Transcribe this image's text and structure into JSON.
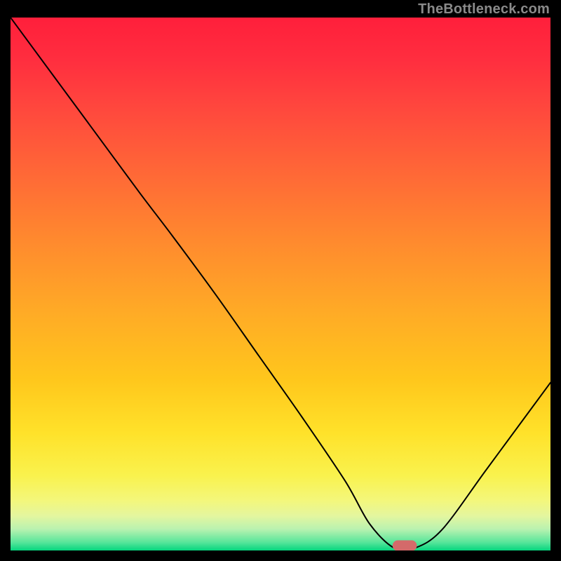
{
  "watermark": "TheBottleneck.com",
  "chart_data": {
    "type": "line",
    "title": "",
    "xlabel": "",
    "ylabel": "",
    "xlim": [
      0,
      100
    ],
    "ylim": [
      0,
      100
    ],
    "grid": false,
    "legend": false,
    "series": [
      {
        "name": "bottleneck-curve",
        "x": [
          0,
          8,
          16,
          24,
          30,
          38,
          46,
          54,
          62,
          66.5,
          71,
          75,
          80,
          88,
          96,
          100
        ],
        "y": [
          100,
          89,
          78,
          67,
          59,
          48,
          36.5,
          25,
          13,
          5,
          0.5,
          0.5,
          4,
          15,
          26,
          31.5
        ]
      }
    ],
    "marker": {
      "x": 73,
      "y": 0.9,
      "width": 4.5,
      "height": 2.0,
      "color": "#d46a6a"
    },
    "gradient_stops": [
      {
        "offset": 0.0,
        "color": "#ff1f3b"
      },
      {
        "offset": 0.08,
        "color": "#ff2e3f"
      },
      {
        "offset": 0.18,
        "color": "#ff4a3d"
      },
      {
        "offset": 0.3,
        "color": "#ff6a36"
      },
      {
        "offset": 0.42,
        "color": "#ff8a2e"
      },
      {
        "offset": 0.55,
        "color": "#ffaa26"
      },
      {
        "offset": 0.68,
        "color": "#ffc71c"
      },
      {
        "offset": 0.78,
        "color": "#ffe22a"
      },
      {
        "offset": 0.86,
        "color": "#f9f24e"
      },
      {
        "offset": 0.905,
        "color": "#f4f77a"
      },
      {
        "offset": 0.935,
        "color": "#e4f69f"
      },
      {
        "offset": 0.96,
        "color": "#b9f2b0"
      },
      {
        "offset": 0.985,
        "color": "#56e59a"
      },
      {
        "offset": 1.0,
        "color": "#05d67e"
      }
    ]
  }
}
